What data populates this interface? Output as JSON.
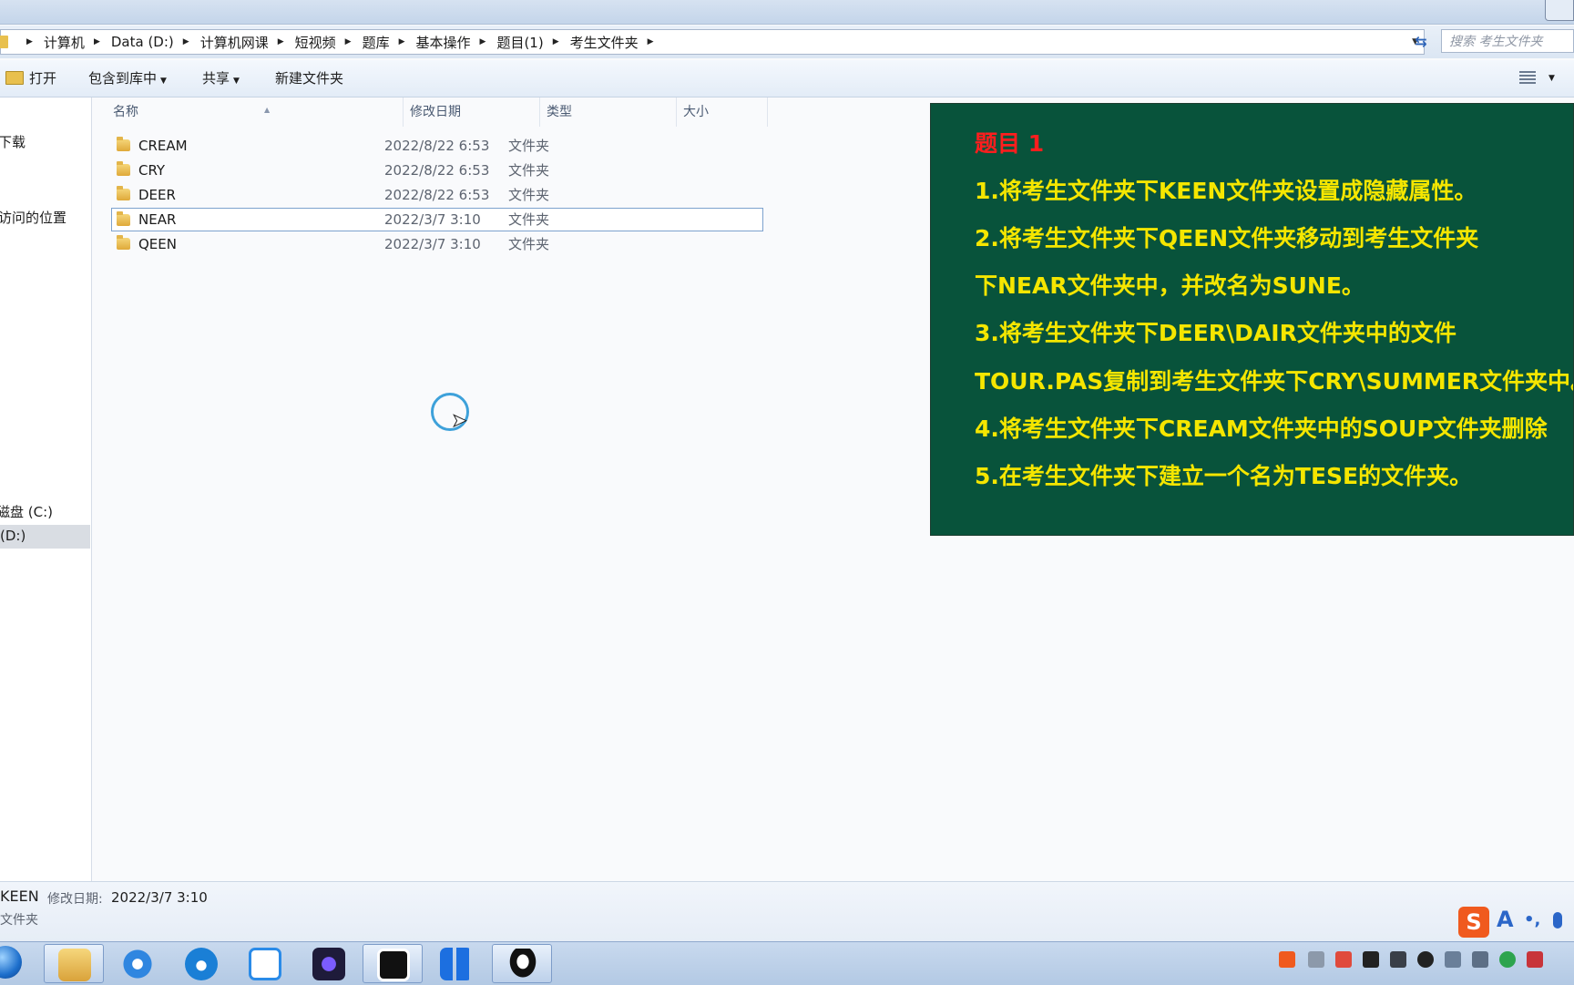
{
  "address": {
    "crumbs": [
      "计算机",
      "Data (D:)",
      "计算机网课",
      "短视频",
      "题库",
      "基本操作",
      "题目(1)",
      "考生文件夹"
    ],
    "search_placeholder": "搜索 考生文件夹"
  },
  "toolbar": {
    "open": "打开",
    "include_in_library": "包含到库中",
    "share": "共享",
    "new_folder": "新建文件夹"
  },
  "nav": {
    "downloads": "下载",
    "recent_places": "访问的位置",
    "local_disk_c": "磁盘 (C:)",
    "data_d": "(D:)"
  },
  "columns": {
    "name": "名称",
    "modified": "修改日期",
    "type": "类型",
    "size": "大小"
  },
  "files": [
    {
      "name": "CREAM",
      "modified": "2022/8/22 6:53",
      "type": "文件夹"
    },
    {
      "name": "CRY",
      "modified": "2022/8/22 6:53",
      "type": "文件夹"
    },
    {
      "name": "DEER",
      "modified": "2022/8/22 6:53",
      "type": "文件夹"
    },
    {
      "name": "NEAR",
      "modified": "2022/3/7 3:10",
      "type": "文件夹"
    },
    {
      "name": "QEEN",
      "modified": "2022/3/7 3:10",
      "type": "文件夹"
    }
  ],
  "panel": {
    "title": "题目 1",
    "lines": [
      "1.将考生文件夹下KEEN文件夹设置成隐藏属性。",
      "2.将考生文件夹下QEEN文件夹移动到考生文件夹",
      "下NEAR文件夹中，并改名为SUNE。",
      "3.将考生文件夹下DEER\\DAIR文件夹中的文件",
      "TOUR.PAS复制到考生文件夹下CRY\\SUMMER文件夹中。",
      "4.将考生文件夹下CREAM文件夹中的SOUP文件夹删除",
      "5.在考生文件夹下建立一个名为TESE的文件夹。"
    ]
  },
  "details": {
    "name": "KEEN",
    "modified_label": "修改日期:",
    "modified_value": "2022/3/7 3:10",
    "type": "文件夹"
  },
  "ime": {
    "logo": "S",
    "mode": "A",
    "punct": "•,"
  },
  "colors": {
    "panel_bg": "#08533b",
    "panel_text": "#f5e600",
    "panel_title": "#ff1e1e",
    "selection_border": "#7da2ce",
    "cursor_ring": "#3ea1da"
  },
  "icons": {
    "taskbar": [
      "start-orb-icon",
      "file-explorer-icon",
      "ie-browser-icon",
      "edge-browser-icon",
      "baidu-netdisk-icon",
      "app-swirl-icon",
      "video-recorder-icon",
      "tiles-app-icon",
      "qq-icon"
    ],
    "tray": [
      "sogou-tray-icon",
      "printer-icon",
      "wps-icon",
      "camera-icon",
      "pen-icon",
      "qq-tray-icon",
      "network-icon",
      "volume-icon",
      "green-status-icon",
      "flag-icon"
    ]
  }
}
